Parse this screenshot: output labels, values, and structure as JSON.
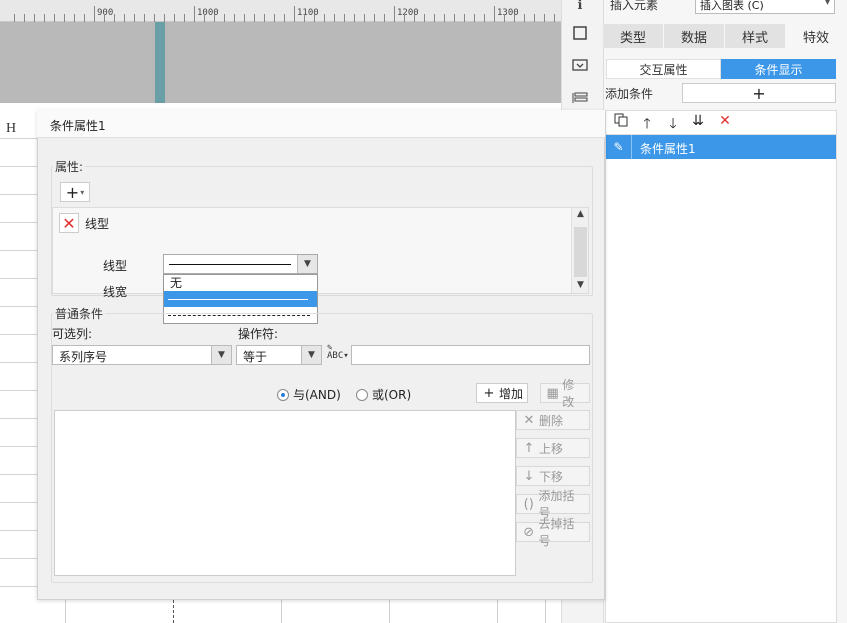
{
  "ruler": {
    "labels": [
      "900",
      "1000",
      "1100",
      "1200",
      "1300"
    ]
  },
  "sheet": {
    "column_header": "H"
  },
  "right_panel": {
    "insert_label": "插入元素",
    "insert_select_value": "插入图表 (C)",
    "tabs": [
      "类型",
      "数据",
      "样式",
      "特效"
    ],
    "active_tab": "特效",
    "subtabs": [
      "交互属性",
      "条件显示"
    ],
    "active_subtab": "条件显示",
    "add_condition_label": "添加条件",
    "add_condition_button": "+",
    "condition_items": [
      "条件属性1"
    ]
  },
  "dialog": {
    "title": "条件属性1",
    "properties_group": "属性:",
    "add_property_button": "+",
    "property_name": "线型",
    "line_type_label": "线型",
    "line_width_label": "线宽",
    "line_type_options": [
      "无",
      "solid",
      "dashed"
    ],
    "line_type_selected": "solid",
    "common_group": "普通条件",
    "available_columns_label": "可选列:",
    "operator_label": "操作符:",
    "column_value": "系列序号",
    "operator_value": "等于",
    "value_input": "",
    "radio_and": "与(AND)",
    "radio_or": "或(OR)",
    "radio_selected": "and",
    "buttons": {
      "add": "增加",
      "modify": "修改",
      "delete": "删除",
      "move_up": "上移",
      "move_down": "下移",
      "add_bracket": "添加括号",
      "remove_bracket": "去掉括号"
    }
  },
  "colors": {
    "accent": "#3c97e8",
    "delete_red": "#e03030"
  }
}
